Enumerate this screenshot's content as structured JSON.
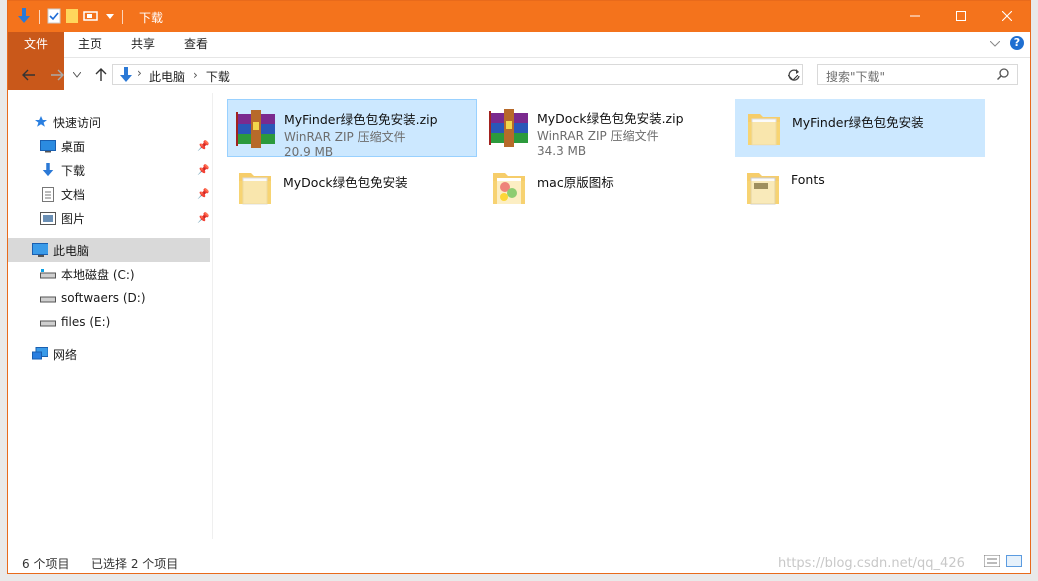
{
  "window": {
    "title": "下载",
    "minimize_icon": "minimize-icon",
    "maximize_icon": "maximize-icon",
    "close_icon": "close-icon",
    "accent": "#f4731c"
  },
  "ribbon": {
    "tabs": [
      "文件",
      "主页",
      "共享",
      "查看"
    ]
  },
  "address": {
    "crumbs": [
      "此电脑",
      "下载"
    ]
  },
  "search": {
    "placeholder": "搜索\"下载\""
  },
  "sidebar": {
    "items": [
      {
        "label": "快速访问",
        "icon": "star-icon"
      },
      {
        "label": "桌面",
        "icon": "desktop-icon",
        "pinned": true
      },
      {
        "label": "下载",
        "icon": "download-icon",
        "pinned": true
      },
      {
        "label": "文档",
        "icon": "document-icon",
        "pinned": true
      },
      {
        "label": "图片",
        "icon": "pictures-icon",
        "pinned": true
      },
      {
        "label": "此电脑",
        "icon": "computer-icon",
        "selected": true
      },
      {
        "label": "本地磁盘 (C:)",
        "icon": "drive-icon"
      },
      {
        "label": "softwaers (D:)",
        "icon": "drive-icon"
      },
      {
        "label": "files (E:)",
        "icon": "drive-icon"
      },
      {
        "label": "网络",
        "icon": "network-icon"
      }
    ]
  },
  "files": [
    {
      "name": "MyFinder绿色包免安装.zip",
      "type": "WinRAR ZIP 压缩文件",
      "size": "20.9 MB",
      "icon": "winrar-archive-icon",
      "selected": true
    },
    {
      "name": "MyDock绿色包免安装.zip",
      "type": "WinRAR ZIP 压缩文件",
      "size": "34.3 MB",
      "icon": "winrar-archive-icon",
      "selected": false
    },
    {
      "name": "MyFinder绿色包免安装",
      "type": "",
      "size": "",
      "icon": "folder-icon",
      "selected": true
    },
    {
      "name": "MyDock绿色包免安装",
      "type": "",
      "size": "",
      "icon": "folder-icon",
      "selected": false
    },
    {
      "name": "mac原版图标",
      "type": "",
      "size": "",
      "icon": "folder-icon",
      "selected": false
    },
    {
      "name": "Fonts",
      "type": "",
      "size": "",
      "icon": "folder-icon",
      "selected": false
    }
  ],
  "status": {
    "count": "6 个项目",
    "selected": "已选择 2 个项目"
  },
  "watermark": "https://blog.csdn.net/qq_426"
}
